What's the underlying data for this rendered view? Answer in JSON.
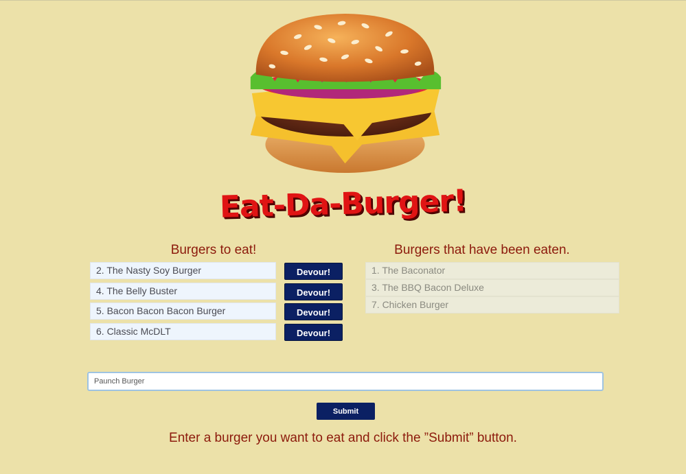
{
  "app": {
    "title": "Eat-Da-Burger!",
    "logo_icon": "burger-icon"
  },
  "to_eat": {
    "heading": "Burgers to eat!",
    "button_label": "Devour!",
    "items": [
      {
        "label": "2. The Nasty Soy Burger"
      },
      {
        "label": "4. The Belly Buster"
      },
      {
        "label": "5. Bacon Bacon Bacon Burger"
      },
      {
        "label": "6. Classic McDLT"
      }
    ]
  },
  "eaten": {
    "heading": "Burgers that have been eaten.",
    "items": [
      {
        "label": "1. The Baconator"
      },
      {
        "label": "3. The BBQ Bacon Deluxe"
      },
      {
        "label": "7. Chicken Burger"
      }
    ]
  },
  "form": {
    "input_value": "Paunch Burger",
    "submit_label": "Submit",
    "instructions": "Enter a burger you want to eat and click the ”Submit” button."
  },
  "colors": {
    "background": "#ece1a9",
    "accent": "#0b2063",
    "heading": "#8c1a0c",
    "title": "#e01414"
  }
}
